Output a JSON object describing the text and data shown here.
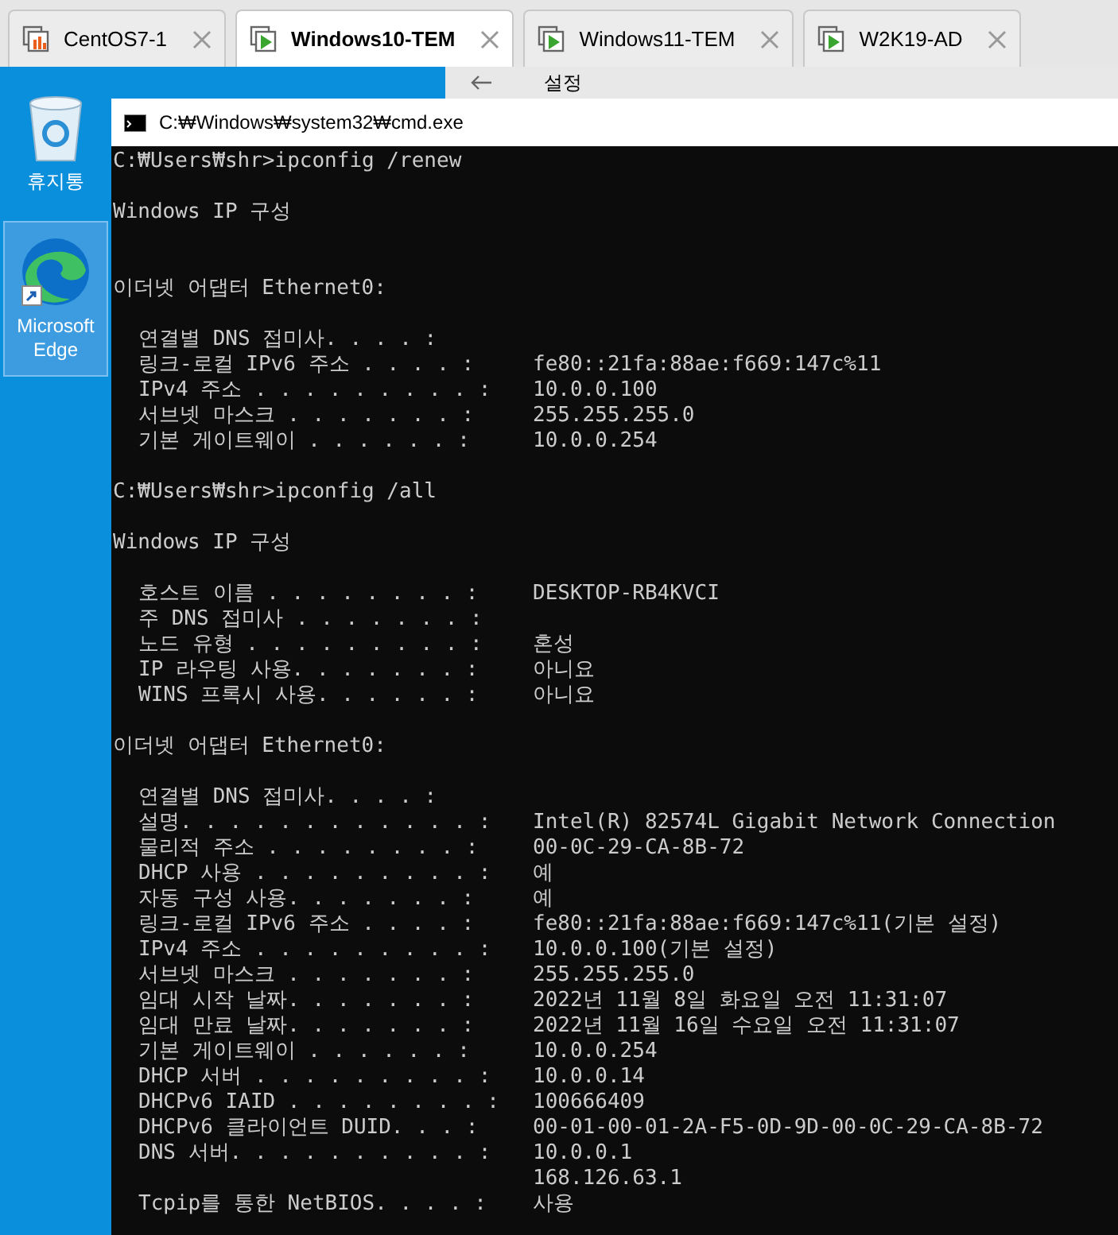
{
  "tabs": [
    {
      "label": "CentOS7-1",
      "selected": false,
      "kind": "stopped"
    },
    {
      "label": "Windows10-TEM",
      "selected": true,
      "kind": "running"
    },
    {
      "label": "Windows11-TEM",
      "selected": false,
      "kind": "running"
    },
    {
      "label": "W2K19-AD",
      "selected": false,
      "kind": "running"
    }
  ],
  "desktop_icons": [
    {
      "label": "휴지통",
      "kind": "recycle",
      "selected": false
    },
    {
      "label": "Microsoft Edge",
      "kind": "browser",
      "selected": true
    }
  ],
  "settings_window": {
    "title": "설정"
  },
  "cmd_window": {
    "title": "C:₩Windows₩system32₩cmd.exe",
    "lines": [
      {
        "kind": "text",
        "text": "C:₩Users₩shr>ipconfig /renew"
      },
      {
        "kind": "blank"
      },
      {
        "kind": "text",
        "text": "Windows IP 구성"
      },
      {
        "kind": "blank"
      },
      {
        "kind": "blank"
      },
      {
        "kind": "text",
        "text": "이더넷 어댑터 Ethernet0:"
      },
      {
        "kind": "blank"
      },
      {
        "kind": "field",
        "label": "연결별 DNS 접미사. . . . :"
      },
      {
        "kind": "field",
        "label": "링크-로컬 IPv6 주소 . . . . :",
        "value": "fe80::21fa:88ae:f669:147c%11"
      },
      {
        "kind": "field",
        "label": "IPv4 주소 . . . . . . . . . :",
        "value": "10.0.0.100"
      },
      {
        "kind": "field",
        "label": "서브넷 마스크 . . . . . . . :",
        "value": "255.255.255.0"
      },
      {
        "kind": "field",
        "label": "기본 게이트웨이 . . . . . . :",
        "value": "10.0.0.254"
      },
      {
        "kind": "blank"
      },
      {
        "kind": "text",
        "text": "C:₩Users₩shr>ipconfig /all"
      },
      {
        "kind": "blank"
      },
      {
        "kind": "text",
        "text": "Windows IP 구성"
      },
      {
        "kind": "blank"
      },
      {
        "kind": "field",
        "label": "호스트 이름 . . . . . . . . :",
        "value": "DESKTOP-RB4KVCI"
      },
      {
        "kind": "field",
        "label": "주 DNS 접미사 . . . . . . . :"
      },
      {
        "kind": "field",
        "label": "노드 유형 . . . . . . . . . :",
        "value": "혼성"
      },
      {
        "kind": "field",
        "label": "IP 라우팅 사용. . . . . . . :",
        "value": "아니요"
      },
      {
        "kind": "field",
        "label": "WINS 프록시 사용. . . . . . :",
        "value": "아니요"
      },
      {
        "kind": "blank"
      },
      {
        "kind": "text",
        "text": "이더넷 어댑터 Ethernet0:"
      },
      {
        "kind": "blank"
      },
      {
        "kind": "field",
        "label": "연결별 DNS 접미사. . . . :"
      },
      {
        "kind": "field",
        "label": "설명. . . . . . . . . . . . :",
        "value": "Intel(R) 82574L Gigabit Network Connection"
      },
      {
        "kind": "field",
        "label": "물리적 주소 . . . . . . . . :",
        "value": "00-0C-29-CA-8B-72"
      },
      {
        "kind": "field",
        "label": "DHCP 사용 . . . . . . . . . :",
        "value": "예"
      },
      {
        "kind": "field",
        "label": "자동 구성 사용. . . . . . . :",
        "value": "예"
      },
      {
        "kind": "field",
        "label": "링크-로컬 IPv6 주소 . . . . :",
        "value": "fe80::21fa:88ae:f669:147c%11(기본 설정)"
      },
      {
        "kind": "field",
        "label": "IPv4 주소 . . . . . . . . . :",
        "value": "10.0.0.100(기본 설정)"
      },
      {
        "kind": "field",
        "label": "서브넷 마스크 . . . . . . . :",
        "value": "255.255.255.0"
      },
      {
        "kind": "field",
        "label": "임대 시작 날짜. . . . . . . :",
        "value": "2022년 11월 8일 화요일 오전 11:31:07"
      },
      {
        "kind": "field",
        "label": "임대 만료 날짜. . . . . . . :",
        "value": "2022년 11월 16일 수요일 오전 11:31:07"
      },
      {
        "kind": "field",
        "label": "기본 게이트웨이 . . . . . . :",
        "value": "10.0.0.254"
      },
      {
        "kind": "field",
        "label": "DHCP 서버 . . . . . . . . . :",
        "value": "10.0.0.14"
      },
      {
        "kind": "field",
        "label": "DHCPv6 IAID . . . . . . . . :",
        "value": "100666409"
      },
      {
        "kind": "field",
        "label": "DHCPv6 클라이언트 DUID. . . :",
        "value": "00-01-00-01-2A-F5-0D-9D-00-0C-29-CA-8B-72"
      },
      {
        "kind": "field",
        "label": "DNS 서버. . . . . . . . . . :",
        "value": "10.0.0.1"
      },
      {
        "kind": "field",
        "value": "168.126.63.1"
      },
      {
        "kind": "field",
        "label": "Tcpip를 통한 NetBIOS. . . . :",
        "value": "사용"
      }
    ]
  }
}
